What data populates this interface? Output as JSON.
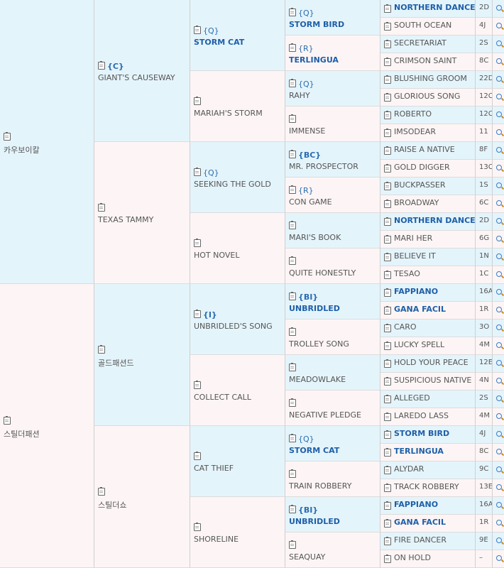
{
  "pedigree": {
    "horses": [
      {
        "name": "카우보이칼",
        "tag": "",
        "sex": "m"
      },
      {
        "name": "GIANT'S CAUSEWAY",
        "tag": "{C}",
        "sex": "m"
      },
      {
        "name": "STORM CAT",
        "tag": "{Q}",
        "sex": "m",
        "bold": true
      },
      {
        "name": "STORM BIRD",
        "tag": "{Q}",
        "sex": "m",
        "bold": true
      },
      {
        "name": "NORTHERN DANCER",
        "tag": "",
        "sex": "m",
        "bold": true,
        "code": "2D"
      },
      {
        "name": "SOUTH OCEAN",
        "tag": "",
        "sex": "f",
        "code": "4J"
      },
      {
        "name": "TERLINGUA",
        "tag": "{R}",
        "sex": "f",
        "bold": true
      },
      {
        "name": "SECRETARIAT",
        "tag": "",
        "sex": "m",
        "code": "2S"
      },
      {
        "name": "CRIMSON SAINT",
        "tag": "",
        "sex": "f",
        "code": "8C"
      },
      {
        "name": "MARIAH'S STORM",
        "tag": "",
        "sex": "f"
      },
      {
        "name": "RAHY",
        "tag": "{Q}",
        "sex": "m"
      },
      {
        "name": "BLUSHING GROOM",
        "tag": "",
        "sex": "m",
        "code": "22D"
      },
      {
        "name": "GLORIOUS SONG",
        "tag": "",
        "sex": "f",
        "code": "12C"
      },
      {
        "name": "IMMENSE",
        "tag": "",
        "sex": "f"
      },
      {
        "name": "ROBERTO",
        "tag": "",
        "sex": "m",
        "code": "12C"
      },
      {
        "name": "IMSODEAR",
        "tag": "",
        "sex": "f",
        "code": "11"
      },
      {
        "name": "TEXAS TAMMY",
        "tag": "",
        "sex": "f"
      },
      {
        "name": "SEEKING THE GOLD",
        "tag": "{Q}",
        "sex": "m"
      },
      {
        "name": "MR. PROSPECTOR",
        "tag": "{BC}",
        "sex": "m"
      },
      {
        "name": "RAISE A NATIVE",
        "tag": "",
        "sex": "m",
        "code": "8F"
      },
      {
        "name": "GOLD DIGGER",
        "tag": "",
        "sex": "f",
        "code": "13C"
      },
      {
        "name": "CON GAME",
        "tag": "{R}",
        "sex": "f"
      },
      {
        "name": "BUCKPASSER",
        "tag": "",
        "sex": "m",
        "code": "1S"
      },
      {
        "name": "BROADWAY",
        "tag": "",
        "sex": "f",
        "code": "6C"
      },
      {
        "name": "HOT NOVEL",
        "tag": "",
        "sex": "f"
      },
      {
        "name": "MARI'S BOOK",
        "tag": "",
        "sex": "m"
      },
      {
        "name": "NORTHERN DANCER",
        "tag": "",
        "sex": "m",
        "bold": true,
        "code": "2D"
      },
      {
        "name": "MARI HER",
        "tag": "",
        "sex": "f",
        "code": "6G"
      },
      {
        "name": "QUITE HONESTLY",
        "tag": "",
        "sex": "f"
      },
      {
        "name": "BELIEVE IT",
        "tag": "",
        "sex": "m",
        "code": "1N"
      },
      {
        "name": "TESAO",
        "tag": "",
        "sex": "f",
        "code": "1C"
      },
      {
        "name": "스틸더패션",
        "tag": "",
        "sex": "f"
      },
      {
        "name": "골드패션드",
        "tag": "",
        "sex": "m"
      },
      {
        "name": "UNBRIDLED'S SONG",
        "tag": "{I}",
        "sex": "m"
      },
      {
        "name": "UNBRIDLED",
        "tag": "{BI}",
        "sex": "m",
        "bold": true
      },
      {
        "name": "FAPPIANO",
        "tag": "",
        "sex": "m",
        "bold": true,
        "code": "16A"
      },
      {
        "name": "GANA FACIL",
        "tag": "",
        "sex": "f",
        "bold": true,
        "code": "1R"
      },
      {
        "name": "TROLLEY SONG",
        "tag": "",
        "sex": "f"
      },
      {
        "name": "CARO",
        "tag": "",
        "sex": "m",
        "code": "3O"
      },
      {
        "name": "LUCKY SPELL",
        "tag": "",
        "sex": "f",
        "code": "4M"
      },
      {
        "name": "COLLECT CALL",
        "tag": "",
        "sex": "f"
      },
      {
        "name": "MEADOWLAKE",
        "tag": "",
        "sex": "m"
      },
      {
        "name": "HOLD YOUR PEACE",
        "tag": "",
        "sex": "m",
        "code": "12E"
      },
      {
        "name": "SUSPICIOUS NATIVE",
        "tag": "",
        "sex": "f",
        "code": "4N"
      },
      {
        "name": "NEGATIVE PLEDGE",
        "tag": "",
        "sex": "f"
      },
      {
        "name": "ALLEGED",
        "tag": "",
        "sex": "m",
        "code": "2S"
      },
      {
        "name": "LAREDO LASS",
        "tag": "",
        "sex": "f",
        "code": "4M"
      },
      {
        "name": "스틸더쇼",
        "tag": "",
        "sex": "f"
      },
      {
        "name": "CAT THIEF",
        "tag": "",
        "sex": "m"
      },
      {
        "name": "STORM CAT",
        "tag": "{Q}",
        "sex": "m",
        "bold": true
      },
      {
        "name": "STORM BIRD",
        "tag": "",
        "sex": "m",
        "bold": true,
        "code": "4J"
      },
      {
        "name": "TERLINGUA",
        "tag": "",
        "sex": "f",
        "bold": true,
        "code": "8C"
      },
      {
        "name": "TRAIN ROBBERY",
        "tag": "",
        "sex": "f"
      },
      {
        "name": "ALYDAR",
        "tag": "",
        "sex": "m",
        "code": "9C"
      },
      {
        "name": "TRACK ROBBERY",
        "tag": "",
        "sex": "f",
        "code": "13E"
      },
      {
        "name": "SHORELINE",
        "tag": "",
        "sex": "f"
      },
      {
        "name": "UNBRIDLED",
        "tag": "{BI}",
        "sex": "m",
        "bold": true
      },
      {
        "name": "FAPPIANO",
        "tag": "",
        "sex": "m",
        "bold": true,
        "code": "16A"
      },
      {
        "name": "GANA FACIL",
        "tag": "",
        "sex": "f",
        "bold": true,
        "code": "1R"
      },
      {
        "name": "SEAQUAY",
        "tag": "",
        "sex": "f"
      },
      {
        "name": "FIRE DANCER",
        "tag": "",
        "sex": "m",
        "code": "9E"
      },
      {
        "name": "ON HOLD",
        "tag": "",
        "sex": "f",
        "code": "–"
      }
    ]
  }
}
